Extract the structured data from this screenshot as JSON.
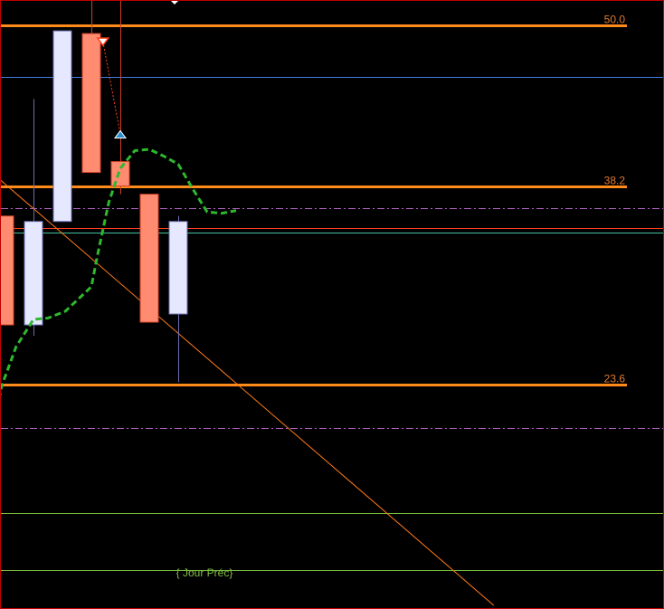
{
  "chart_data": {
    "type": "candlestick",
    "title": "",
    "fib_levels": [
      {
        "label": "50.0",
        "value": 50.0
      },
      {
        "label": "38.2",
        "value": 38.2
      },
      {
        "label": "23.6",
        "value": 23.6
      }
    ],
    "candles": [
      {
        "open": 36.0,
        "close": 28.0,
        "high": 36.0,
        "low": 28.0,
        "dir": "down"
      },
      {
        "open": 28.0,
        "close": 35.6,
        "high": 44.6,
        "low": 27.2,
        "dir": "up"
      },
      {
        "open": 35.6,
        "close": 49.6,
        "high": 49.6,
        "low": 35.6,
        "dir": "up"
      },
      {
        "open": 49.4,
        "close": 39.2,
        "high": 52.8,
        "low": 39.2,
        "dir": "down"
      },
      {
        "open": 40.0,
        "close": 38.2,
        "high": 52.8,
        "low": 37.6,
        "dir": "down"
      },
      {
        "open": 37.6,
        "close": 28.2,
        "high": 37.6,
        "low": 28.2,
        "dir": "down"
      },
      {
        "open": 28.8,
        "close": 35.6,
        "high": 36.0,
        "low": 23.8,
        "dir": "up"
      }
    ],
    "dashed_average": [
      {
        "i": -1.1,
        "v": 14.0
      },
      {
        "i": -0.6,
        "v": 18.0
      },
      {
        "i": -0.1,
        "v": 23.5
      },
      {
        "i": 0.4,
        "v": 26.4
      },
      {
        "i": 1.0,
        "v": 28.4
      },
      {
        "i": 1.5,
        "v": 28.5
      },
      {
        "i": 2.1,
        "v": 29.0
      },
      {
        "i": 3.0,
        "v": 30.8
      },
      {
        "i": 3.2,
        "v": 33.0
      },
      {
        "i": 3.6,
        "v": 37.0
      },
      {
        "i": 4.0,
        "v": 39.5
      },
      {
        "i": 4.5,
        "v": 40.8
      },
      {
        "i": 5.0,
        "v": 40.9
      },
      {
        "i": 5.5,
        "v": 40.4
      },
      {
        "i": 6.0,
        "v": 39.8
      },
      {
        "i": 6.5,
        "v": 38.0
      },
      {
        "i": 7.0,
        "v": 36.3
      },
      {
        "i": 7.5,
        "v": 36.2
      },
      {
        "i": 8.0,
        "v": 36.4
      }
    ],
    "horizontal_lines": [
      {
        "value": 46.2,
        "color": "#3f7fe0",
        "style": "solid"
      },
      {
        "value": 36.6,
        "color": "#b060c0",
        "style": "dashdot"
      },
      {
        "value": 35.1,
        "color": "#ff4020",
        "style": "solid"
      },
      {
        "value": 34.8,
        "color": "#40c0a0",
        "style": "solid"
      },
      {
        "value": 20.4,
        "color": "#b060c0",
        "style": "dashdot"
      },
      {
        "value": 14.2,
        "color": "#7fbf3f",
        "style": "solid"
      },
      {
        "value": 10.0,
        "color": "#7fbf3f",
        "style": "solid"
      }
    ],
    "trendline": [
      {
        "i": -1.1,
        "v": 40.4
      },
      {
        "i": 16.9,
        "v": 7.4
      }
    ],
    "sell_marker": {
      "i": 3.4,
      "v": 48.8
    },
    "buy_marker": {
      "i": 4.0,
      "v": 42.0
    },
    "ylim": [
      7.2,
      51.8
    ],
    "annotation": "{ Jour Préc}",
    "colors": {
      "fib": "#ff8c1a",
      "up_fill": "#e6e8ff",
      "up_edge": "#6b6fb0",
      "down_fill": "#ff8c70",
      "down_edge": "#d0402a",
      "average": "#2eb82e",
      "trend": "#ff7a1a",
      "border": "#c00000"
    }
  }
}
